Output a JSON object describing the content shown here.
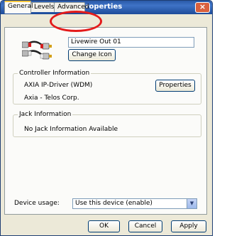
{
  "window": {
    "title": "Livewire Out 01 Properties",
    "close_glyph": "×",
    "icon": "speaker-icon"
  },
  "tabs": [
    {
      "label": "General",
      "active": true
    },
    {
      "label": "Levels",
      "active": false
    },
    {
      "label": "Advanced",
      "active": false
    }
  ],
  "general": {
    "device_name": "Livewire Out 01",
    "device_icon": "rca-cable-icon",
    "change_icon_label": "Change Icon",
    "controller": {
      "heading": "Controller Information",
      "driver": "AXIA IP-Driver (WDM)",
      "manufacturer": "Axia - Telos Corp.",
      "properties_label": "Properties"
    },
    "jack": {
      "heading": "Jack Information",
      "text": "No Jack Information Available"
    },
    "device_usage": {
      "label": "Device usage:",
      "value": "Use this device (enable)"
    }
  },
  "footer": {
    "ok_label": "OK",
    "cancel_label": "Cancel",
    "apply_label": "Apply"
  },
  "colors": {
    "annotation_circle": "#e41b1b",
    "title_bar": "#2b5aa8",
    "face": "#ece9d8"
  }
}
